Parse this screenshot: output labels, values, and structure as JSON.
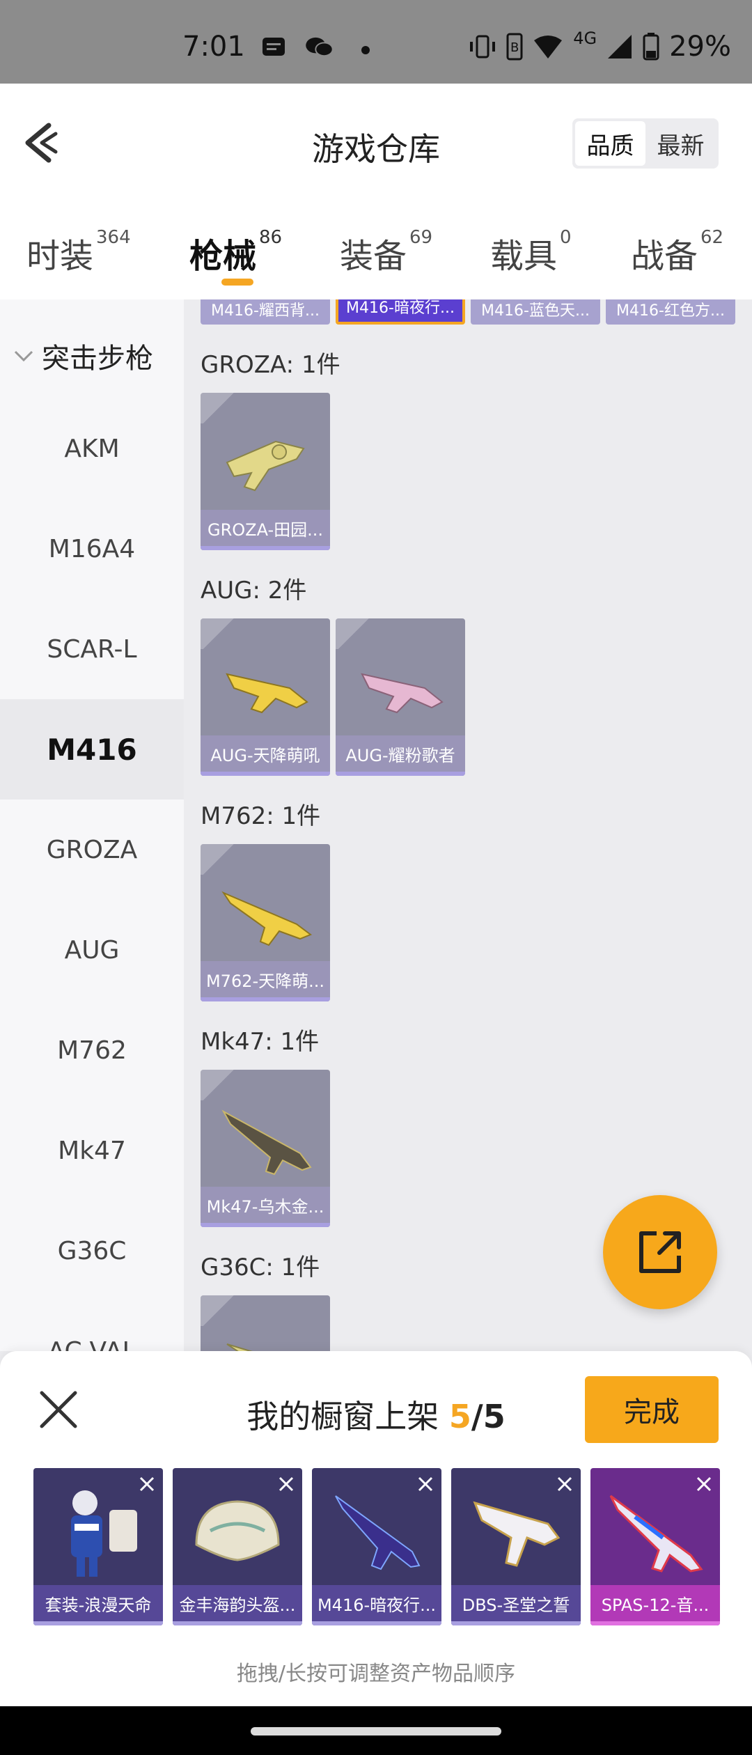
{
  "status_bar": {
    "time": "7:01",
    "network": "4G",
    "battery": "29%"
  },
  "header": {
    "title": "游戏仓库",
    "sort_options": [
      "品质",
      "最新"
    ]
  },
  "tabs": [
    {
      "label": "时装",
      "count": "364"
    },
    {
      "label": "枪械",
      "count": "86"
    },
    {
      "label": "装备",
      "count": "69"
    },
    {
      "label": "载具",
      "count": "0"
    },
    {
      "label": "战备",
      "count": "62"
    }
  ],
  "sidebar": {
    "category": "突击步枪",
    "items": [
      "AKM",
      "M16A4",
      "SCAR-L",
      "M416",
      "GROZA",
      "AUG",
      "M762",
      "Mk47",
      "G36C",
      "AC-VAL"
    ]
  },
  "top_row_cards": [
    "M416-耀西背...",
    "M416-暗夜行...",
    "M416-蓝色天...",
    "M416-红色方..."
  ],
  "groups": [
    {
      "title": "GROZA: 1件",
      "items": [
        "GROZA-田园..."
      ]
    },
    {
      "title": "AUG: 2件",
      "items": [
        "AUG-天降萌吼",
        "AUG-耀粉歌者"
      ]
    },
    {
      "title": "M762: 1件",
      "items": [
        "M762-天降萌..."
      ]
    },
    {
      "title": "Mk47: 1件",
      "items": [
        "Mk47-乌木金..."
      ]
    },
    {
      "title": "G36C: 1件",
      "items": [
        ""
      ]
    }
  ],
  "showcase": {
    "title": "我的橱窗上架",
    "count": "5",
    "separator": "/",
    "total": "5",
    "done_label": "完成",
    "items": [
      "套装-浪漫天命",
      "金丰海韵头盔...",
      "M416-暗夜行...",
      "DBS-圣堂之誓",
      "SPAS-12-音..."
    ],
    "hint": "拖拽/长按可调整资产物品顺序"
  },
  "colors": {
    "accent": "#f7a81b",
    "card_label": "#9a95b8",
    "selected_card": "#5b3fd0"
  }
}
